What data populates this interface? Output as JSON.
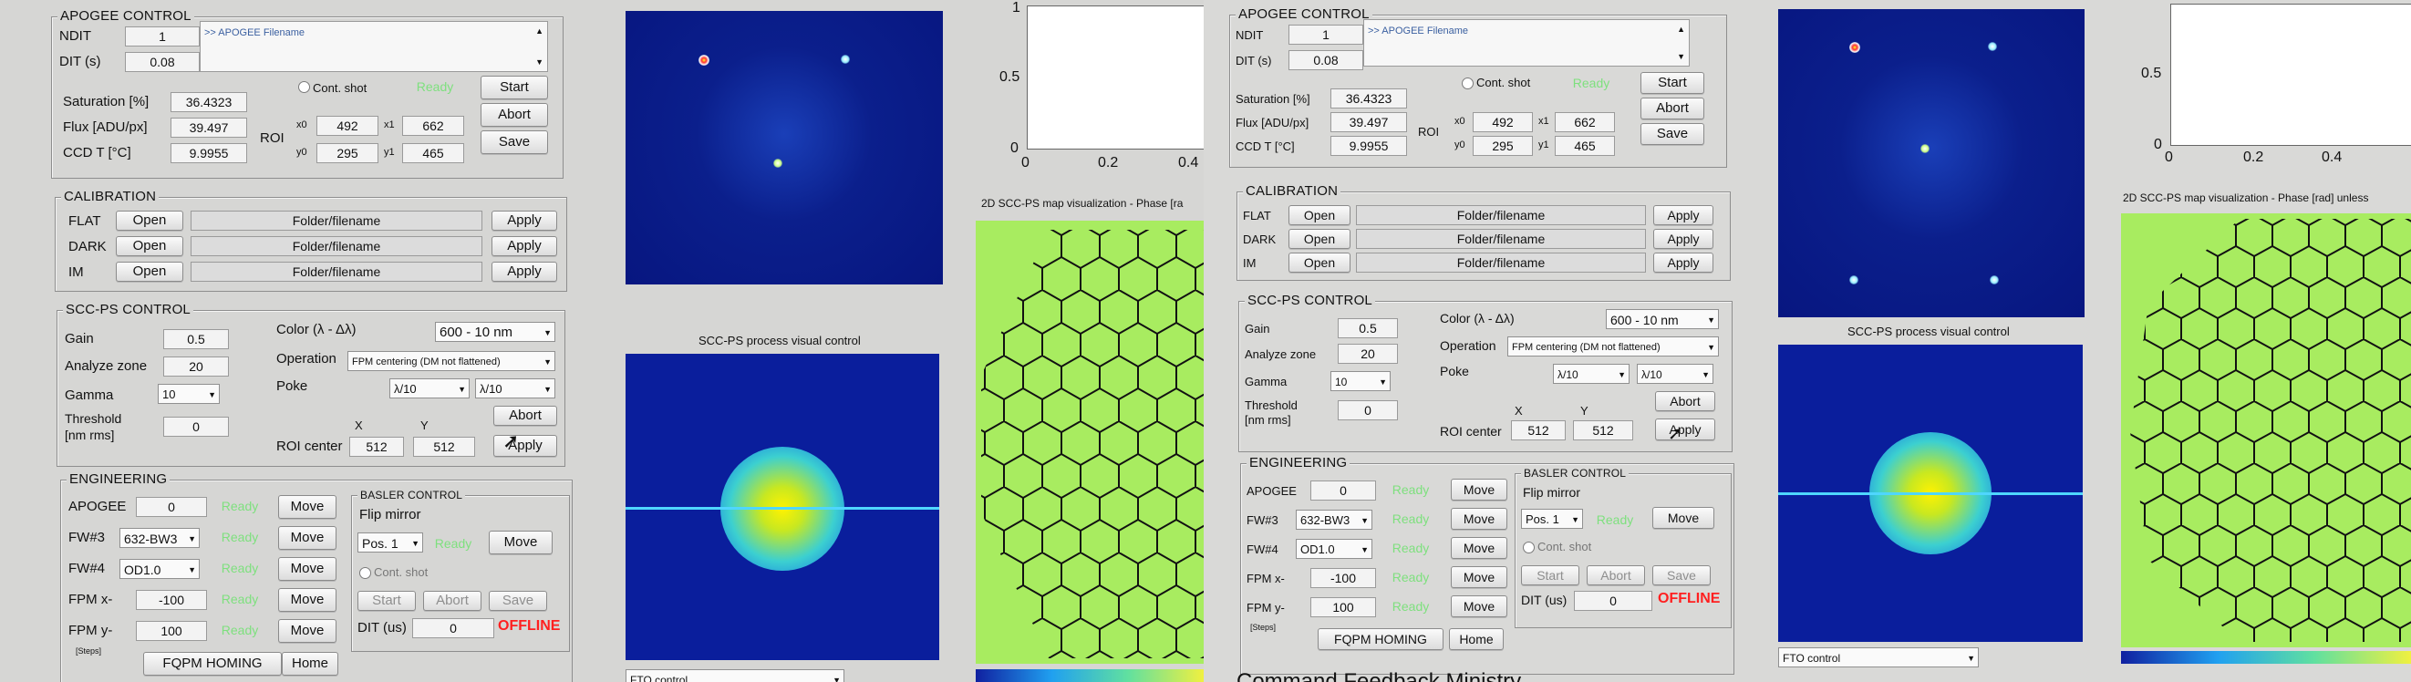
{
  "apogee": {
    "title": "APOGEE CONTROL",
    "ndit_label": "NDIT",
    "ndit_value": "1",
    "dit_label": "DIT (s)",
    "dit_value": "0.08",
    "filename": ">> APOGEE Filename",
    "cont_shot": "Cont. shot",
    "status": "Ready",
    "start": "Start",
    "abort": "Abort",
    "save": "Save",
    "saturation_label": "Saturation [%]",
    "saturation_value": "36.4323",
    "flux_label": "Flux [ADU/px]",
    "flux_value": "39.497",
    "ccd_label": "CCD T [°C]",
    "ccd_value": "9.9955",
    "roi_label": "ROI",
    "x0_label": "x0",
    "x0_value": "492",
    "x1_label": "x1",
    "x1_value": "662",
    "y0_label": "y0",
    "y0_value": "295",
    "y1_label": "y1",
    "y1_value": "465"
  },
  "calibration": {
    "title": "CALIBRATION",
    "rows": [
      {
        "label": "FLAT",
        "open": "Open",
        "file": "Folder/filename",
        "apply": "Apply"
      },
      {
        "label": "DARK",
        "open": "Open",
        "file": "Folder/filename",
        "apply": "Apply"
      },
      {
        "label": "IM",
        "open": "Open",
        "file": "Folder/filename",
        "apply": "Apply"
      }
    ]
  },
  "sccps": {
    "title": "SCC-PS CONTROL",
    "gain_label": "Gain",
    "gain_value": "0.5",
    "analyze_label": "Analyze zone",
    "analyze_value": "20",
    "gamma_label": "Gamma",
    "gamma_value": "10",
    "threshold_label": "Threshold",
    "threshold_unit": "[nm rms]",
    "threshold_value": "0",
    "color_label": "Color (λ - Δλ)",
    "color_value": "600 - 10 nm",
    "operation_label": "Operation",
    "operation_value": "FPM centering (DM not flattened)",
    "poke_label": "Poke",
    "poke_a": "λ/10",
    "poke_b": "λ/10",
    "abort": "Abort",
    "x_label": "X",
    "y_label": "Y",
    "roi_center_label": "ROI center",
    "roi_x": "512",
    "roi_y": "512",
    "apply": "Apply"
  },
  "engineering": {
    "title": "ENGINEERING",
    "rows": [
      {
        "label": "APOGEE",
        "value": "0",
        "status": "Ready",
        "move": "Move"
      },
      {
        "label": "FW#3",
        "value": "632-BW3",
        "status": "Ready",
        "move": "Move"
      },
      {
        "label": "FW#4",
        "value": "OD1.0",
        "status": "Ready",
        "move": "Move"
      },
      {
        "label": "FPM x-",
        "value": "-100",
        "status": "Ready",
        "move": "Move"
      },
      {
        "label": "FPM y-",
        "value": "100",
        "status": "Ready",
        "move": "Move"
      }
    ],
    "steps": "[Steps]",
    "homing": "FQPM HOMING",
    "home": "Home"
  },
  "basler": {
    "title": "BASLER CONTROL",
    "flip_label": "Flip mirror",
    "pos_value": "Pos. 1",
    "status": "Ready",
    "move": "Move",
    "cont_shot": "Cont. shot",
    "start": "Start",
    "abort": "Abort",
    "save": "Save",
    "dit_label": "DIT (us)",
    "dit_value": "0",
    "offline": "OFFLINE"
  },
  "visual": {
    "scc_caption": "SCC-PS process visual control",
    "map_caption_1": "2D SCC-PS map visualization - Phase [ra",
    "map_caption_2": "2D SCC-PS map visualization - Phase [rad] unless",
    "fto": "FTO control",
    "bottom_text": "Command Feedback Ministry"
  },
  "plot": {
    "y_ticks": [
      "1",
      "0.5",
      "0"
    ],
    "x_ticks": [
      "0",
      "0.2",
      "0.4"
    ]
  },
  "colors": {
    "ready": "#7ee07e",
    "offline": "#ff2020",
    "map_bg": "#a8ec60"
  }
}
